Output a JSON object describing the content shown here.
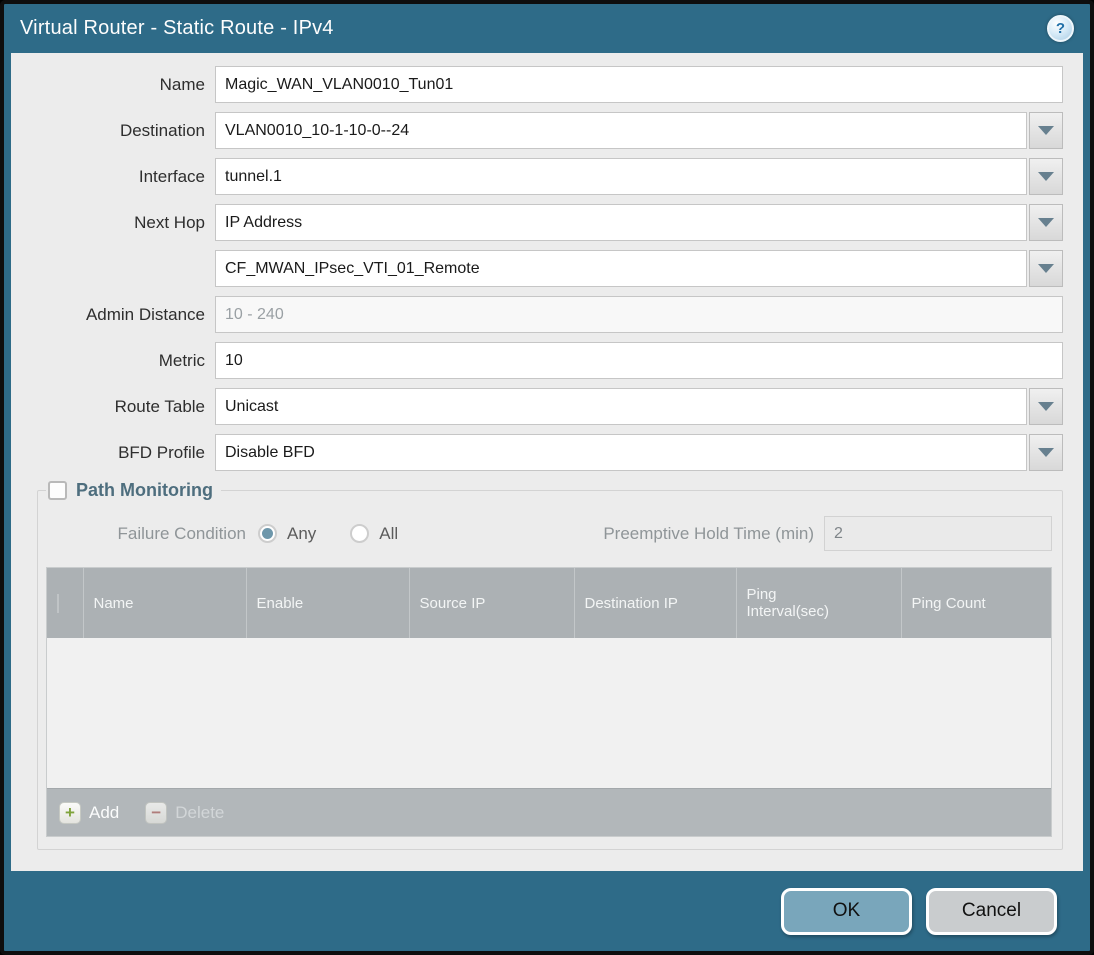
{
  "titlebar": {
    "title": "Virtual Router - Static Route - IPv4",
    "help_icon_glyph": "?"
  },
  "form": {
    "name": {
      "label": "Name",
      "value": "Magic_WAN_VLAN0010_Tun01"
    },
    "destination": {
      "label": "Destination",
      "value": "VLAN0010_10-1-10-0--24"
    },
    "interface": {
      "label": "Interface",
      "value": "tunnel.1"
    },
    "next_hop": {
      "label": "Next Hop",
      "value": "IP Address"
    },
    "next_hop_address": {
      "label": "",
      "value": "CF_MWAN_IPsec_VTI_01_Remote"
    },
    "admin_distance": {
      "label": "Admin Distance",
      "placeholder": "10 - 240"
    },
    "metric": {
      "label": "Metric",
      "value": "10"
    },
    "route_table": {
      "label": "Route Table",
      "value": "Unicast"
    },
    "bfd_profile": {
      "label": "BFD Profile",
      "value": "Disable BFD"
    }
  },
  "path_monitoring": {
    "title": "Path Monitoring",
    "enabled": false,
    "failure_condition": {
      "label": "Failure Condition",
      "options": [
        {
          "label": "Any",
          "selected": true
        },
        {
          "label": "All",
          "selected": false
        }
      ]
    },
    "preemptive_hold_time": {
      "label": "Preemptive Hold Time (min)",
      "value": "2"
    },
    "table": {
      "columns": [
        "Name",
        "Enable",
        "Source IP",
        "Destination IP",
        "Ping Interval(sec)",
        "Ping Count"
      ],
      "rows": []
    },
    "toolbar": {
      "add_label": "Add",
      "add_icon_glyph": "+",
      "delete_label": "Delete",
      "delete_icon_glyph": "−",
      "delete_enabled": false
    }
  },
  "footer": {
    "ok_label": "OK",
    "cancel_label": "Cancel"
  },
  "colors": {
    "chrome_teal": "#2E6B88",
    "content_bg": "#ECECEC",
    "table_header_gray": "#ACB1B4",
    "toolbar_gray": "#B2B7BA",
    "ok_button": "#79A6BB",
    "cancel_button": "#C9CCCE",
    "radio_selected": "#6E97AB",
    "pm_title": "#4E6E7E"
  }
}
